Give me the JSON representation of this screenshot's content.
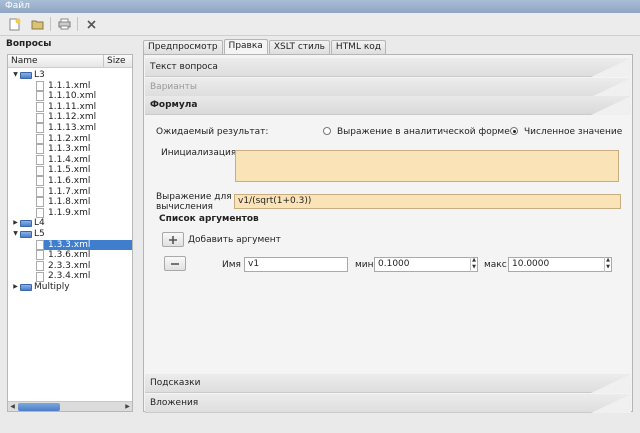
{
  "window": {
    "menu_title": "Файл"
  },
  "toolbar": {
    "icons": [
      "new-file-icon",
      "open-folder-icon",
      "print-icon",
      "delete-icon"
    ]
  },
  "left": {
    "title": "Вопросы",
    "columns": [
      "Name",
      "Size"
    ],
    "tree": [
      {
        "label": "L3",
        "type": "folder",
        "expanded": true,
        "depth": 0
      },
      {
        "label": "1.1.1.xml",
        "type": "file",
        "depth": 1
      },
      {
        "label": "1.1.10.xml",
        "type": "file",
        "depth": 1
      },
      {
        "label": "1.1.11.xml",
        "type": "file",
        "depth": 1
      },
      {
        "label": "1.1.12.xml",
        "type": "file",
        "depth": 1
      },
      {
        "label": "1.1.13.xml",
        "type": "file",
        "depth": 1
      },
      {
        "label": "1.1.2.xml",
        "type": "file",
        "depth": 1
      },
      {
        "label": "1.1.3.xml",
        "type": "file",
        "depth": 1
      },
      {
        "label": "1.1.4.xml",
        "type": "file",
        "depth": 1
      },
      {
        "label": "1.1.5.xml",
        "type": "file",
        "depth": 1
      },
      {
        "label": "1.1.6.xml",
        "type": "file",
        "depth": 1
      },
      {
        "label": "1.1.7.xml",
        "type": "file",
        "depth": 1
      },
      {
        "label": "1.1.8.xml",
        "type": "file",
        "depth": 1
      },
      {
        "label": "1.1.9.xml",
        "type": "file",
        "depth": 1
      },
      {
        "label": "L4",
        "type": "folder",
        "expanded": false,
        "depth": 0
      },
      {
        "label": "L5",
        "type": "folder",
        "expanded": true,
        "depth": 0
      },
      {
        "label": "1.3.3.xml",
        "type": "file",
        "depth": 1,
        "selected": true
      },
      {
        "label": "1.3.6.xml",
        "type": "file",
        "depth": 1
      },
      {
        "label": "2.3.3.xml",
        "type": "file",
        "depth": 1
      },
      {
        "label": "2.3.4.xml",
        "type": "file",
        "depth": 1
      },
      {
        "label": "Multiply",
        "type": "folder",
        "expanded": false,
        "depth": 0
      }
    ]
  },
  "tabs": [
    {
      "label": "Предпросмотр",
      "active": false
    },
    {
      "label": "Правка",
      "active": true
    },
    {
      "label": "XSLT стиль",
      "active": false
    },
    {
      "label": "HTML код",
      "active": false
    }
  ],
  "sections": {
    "question_text": "Текст вопроса",
    "variants": "Варианты",
    "formula": "Формула",
    "hints": "Подсказки",
    "attachments": "Вложения"
  },
  "formula": {
    "expected_result_label": "Ожидаемый результат:",
    "option_analytic": "Выражение в аналитической форме",
    "option_numeric": "Численное значение",
    "selected_option": "numeric",
    "init_label": "Инициализация",
    "init_value": "",
    "expr_label_line1": "Выражение для",
    "expr_label_line2": "вычисления",
    "expr_value": "v1/(sqrt(1+0.3))",
    "args_title": "Список аргументов",
    "add_arg_label": "Добавить аргумент",
    "arg": {
      "name_label": "Имя",
      "name_value": "v1",
      "min_label": "мин",
      "min_value": "0.1000",
      "max_label": "макс",
      "max_value": "10.0000"
    }
  },
  "colors": {
    "accent": "#3f7dcd",
    "input_bg": "#fbe3b8"
  }
}
